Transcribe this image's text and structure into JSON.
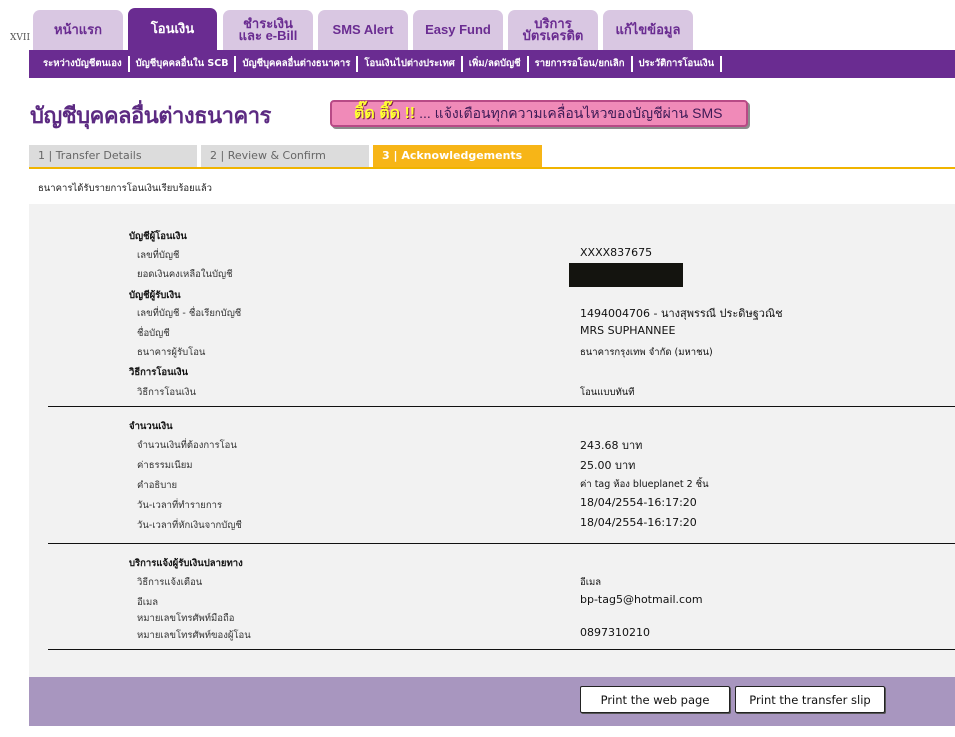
{
  "brand": {
    "mark": "XVII"
  },
  "top_tabs": [
    {
      "label": "หน้าแรก"
    },
    {
      "label": "โอนเงิน",
      "active": true
    },
    {
      "label": "ชำระเงิน\nและ e-Bill"
    },
    {
      "label": "SMS Alert"
    },
    {
      "label": "Easy Fund"
    },
    {
      "label": "บริการ\nบัตรเครดิต"
    },
    {
      "label": "แก้ไขข้อมูล"
    }
  ],
  "sub_nav": [
    "ระหว่างบัญชีตนเอง",
    "บัญชีบุคคลอื่นใน SCB",
    "บัญชีบุคคลอื่นต่างธนาคาร",
    "โอนเงินไปต่างประเทศ",
    "เพิ่ม/ลดบัญชี",
    "รายการรอโอน/ยกเลิก",
    "ประวัติการโอนเงิน"
  ],
  "page_title": "บัญชีบุคคลอื่นต่างธนาคาร",
  "sms_banner": {
    "ding": "ติ๊ด ติ๊ด !!",
    "text": "... แจ้งเตือนทุกความเคลื่อนไหวของบัญชีผ่าน SMS"
  },
  "steps": [
    {
      "label": "1 | Transfer Details"
    },
    {
      "label": "2 | Review & Confirm"
    },
    {
      "label": "3 | Acknowledgements",
      "active": true
    }
  ],
  "confirm_message": "ธนาคารได้รับรายการโอนเงินเรียบร้อยแล้ว",
  "from_account": {
    "header": "บัญชีผู้โอนเงิน",
    "account_no_label": "เลขที่บัญชี",
    "account_no": "XXXX837675",
    "balance_label": "ยอดเงินคงเหลือในบัญชี"
  },
  "to_account": {
    "header": "บัญชีผู้รับเงิน",
    "account_label": "เลขที่บัญชี - ชื่อเรียกบัญชี",
    "account_value": "1494004706 - นางสุพรรณี ประดิษฐวณิช",
    "name_label": "ชื่อบัญชี",
    "name_value": "MRS SUPHANNEE",
    "bank_label": "ธนาคารผู้รับโอน",
    "bank_value": "ธนาคารกรุงเทพ จำกัด (มหาชน)"
  },
  "method": {
    "header": "วิธีการโอนเงิน",
    "label": "วิธีการโอนเงิน",
    "value": "โอนแบบทันที"
  },
  "amount": {
    "header": "จำนวนเงิน",
    "amount_label": "จำนวนเงินที่ต้องการโอน",
    "amount_value": "243.68 บาท",
    "fee_label": "ค่าธรรมเนียม",
    "fee_value": "25.00 บาท",
    "desc_label": "คำอธิบาย",
    "desc_value": "ค่า tag ห้อง blueplanet 2 ชิ้น",
    "txn_time_label": "วัน-เวลาที่ทำรายการ",
    "txn_time_value": "18/04/2554-16:17:20",
    "debit_time_label": "วัน-เวลาที่หักเงินจากบัญชี",
    "debit_time_value": "18/04/2554-16:17:20"
  },
  "notify": {
    "header": "บริการแจ้งผู้รับเงินปลายทาง",
    "method_label": "วิธีการแจ้งเตือน",
    "method_value": "อีเมล",
    "email_label": "อีเมล",
    "email_value": "bp-tag5@hotmail.com",
    "mobile_label": "หมายเลขโทรศัพท์มือถือ",
    "sender_phone_label": "หมายเลขโทรศัพท์ของผู้โอน",
    "sender_phone_value": "0897310210"
  },
  "buttons": {
    "print_page": "Print the web page",
    "print_slip": "Print the transfer slip"
  },
  "colors": {
    "brand_purple": "#6a2c91",
    "tab_light": "#d9c7e2",
    "step_active": "#f7b517",
    "footer": "#a896bf"
  }
}
